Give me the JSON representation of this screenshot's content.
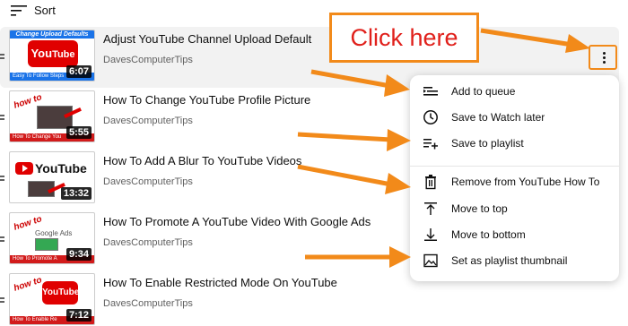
{
  "sort": {
    "label": "Sort",
    "icon": "sort-icon"
  },
  "videos": [
    {
      "title": "Adjust YouTube Channel Upload Default",
      "channel": "DavesComputerTips",
      "duration": "6:07",
      "thumb_caption": "Change Upload Defaults",
      "thumb_strip": "Easy To Follow Steps"
    },
    {
      "title": "How To Change YouTube Profile Picture",
      "channel": "DavesComputerTips",
      "duration": "5:55",
      "thumb_caption": "how to",
      "thumb_strip": "How To Change You"
    },
    {
      "title": "How To Add A Blur To YouTube Videos",
      "channel": "DavesComputerTips",
      "duration": "13:32",
      "thumb_caption": "YouTube",
      "thumb_strip": ""
    },
    {
      "title": "How To Promote A YouTube Video With Google Ads",
      "channel": "DavesComputerTips",
      "duration": "9:34",
      "thumb_caption": "how to",
      "thumb_strip": "How To Promote A"
    },
    {
      "title": "How To Enable Restricted Mode On YouTube",
      "channel": "DavesComputerTips",
      "duration": "7:12",
      "thumb_caption": "how to",
      "thumb_strip": "How To Enable Re"
    }
  ],
  "menu": {
    "items": [
      {
        "label": "Add to queue",
        "icon": "add-to-queue-icon"
      },
      {
        "label": "Save to Watch later",
        "icon": "clock-icon"
      },
      {
        "label": "Save to playlist",
        "icon": "playlist-add-icon"
      },
      {
        "label": "Remove from YouTube How To",
        "icon": "trash-icon"
      },
      {
        "label": "Move to top",
        "icon": "move-to-top-icon"
      },
      {
        "label": "Move to bottom",
        "icon": "move-to-bottom-icon"
      },
      {
        "label": "Set as playlist thumbnail",
        "icon": "image-icon"
      }
    ]
  },
  "callout": {
    "text": "Click here"
  },
  "colors": {
    "accent_orange": "#f28a1a",
    "callout_text": "#e0201b",
    "youtube_red": "#e00000"
  }
}
